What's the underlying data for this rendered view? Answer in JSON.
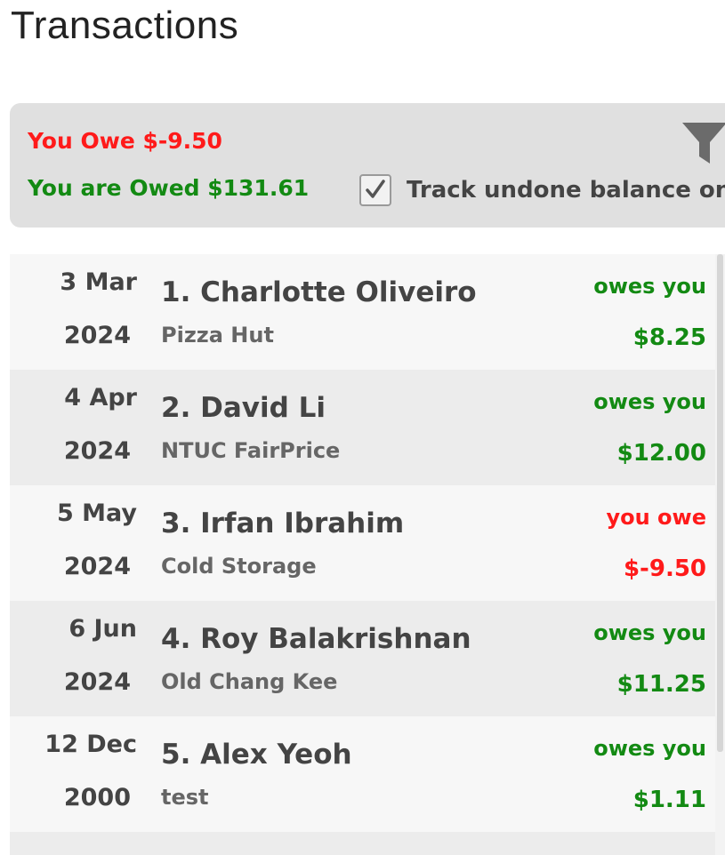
{
  "page": {
    "title": "Transactions"
  },
  "summary": {
    "you_owe": "You Owe $-9.50",
    "you_are_owed": "You are Owed $131.61",
    "track_undone_label": "Track undone balance only",
    "track_undone_checked": true,
    "filter_icon": "filter-icon"
  },
  "colors": {
    "owes_you": "#138a13",
    "you_owe": "#ff1a1a",
    "panel": "#e0e0e0"
  },
  "transactions": [
    {
      "date": "3 Mar",
      "year": "2024",
      "name": "1. Charlotte Oliveiro",
      "merchant": "Pizza Hut",
      "status": "owes you",
      "amount": "$8.25",
      "kind": "owes-you"
    },
    {
      "date": "4 Apr",
      "year": "2024",
      "name": "2. David Li",
      "merchant": "NTUC FairPrice",
      "status": "owes you",
      "amount": "$12.00",
      "kind": "owes-you"
    },
    {
      "date": "5 May",
      "year": "2024",
      "name": "3. Irfan Ibrahim",
      "merchant": "Cold Storage",
      "status": "you owe",
      "amount": "$-9.50",
      "kind": "you-owe"
    },
    {
      "date": "6 Jun",
      "year": "2024",
      "name": "4. Roy Balakrishnan",
      "merchant": "Old Chang Kee",
      "status": "owes you",
      "amount": "$11.25",
      "kind": "owes-you"
    },
    {
      "date": "12 Dec",
      "year": "2000",
      "name": "5. Alex Yeoh",
      "merchant": "test",
      "status": "owes you",
      "amount": "$1.11",
      "kind": "owes-you"
    }
  ]
}
